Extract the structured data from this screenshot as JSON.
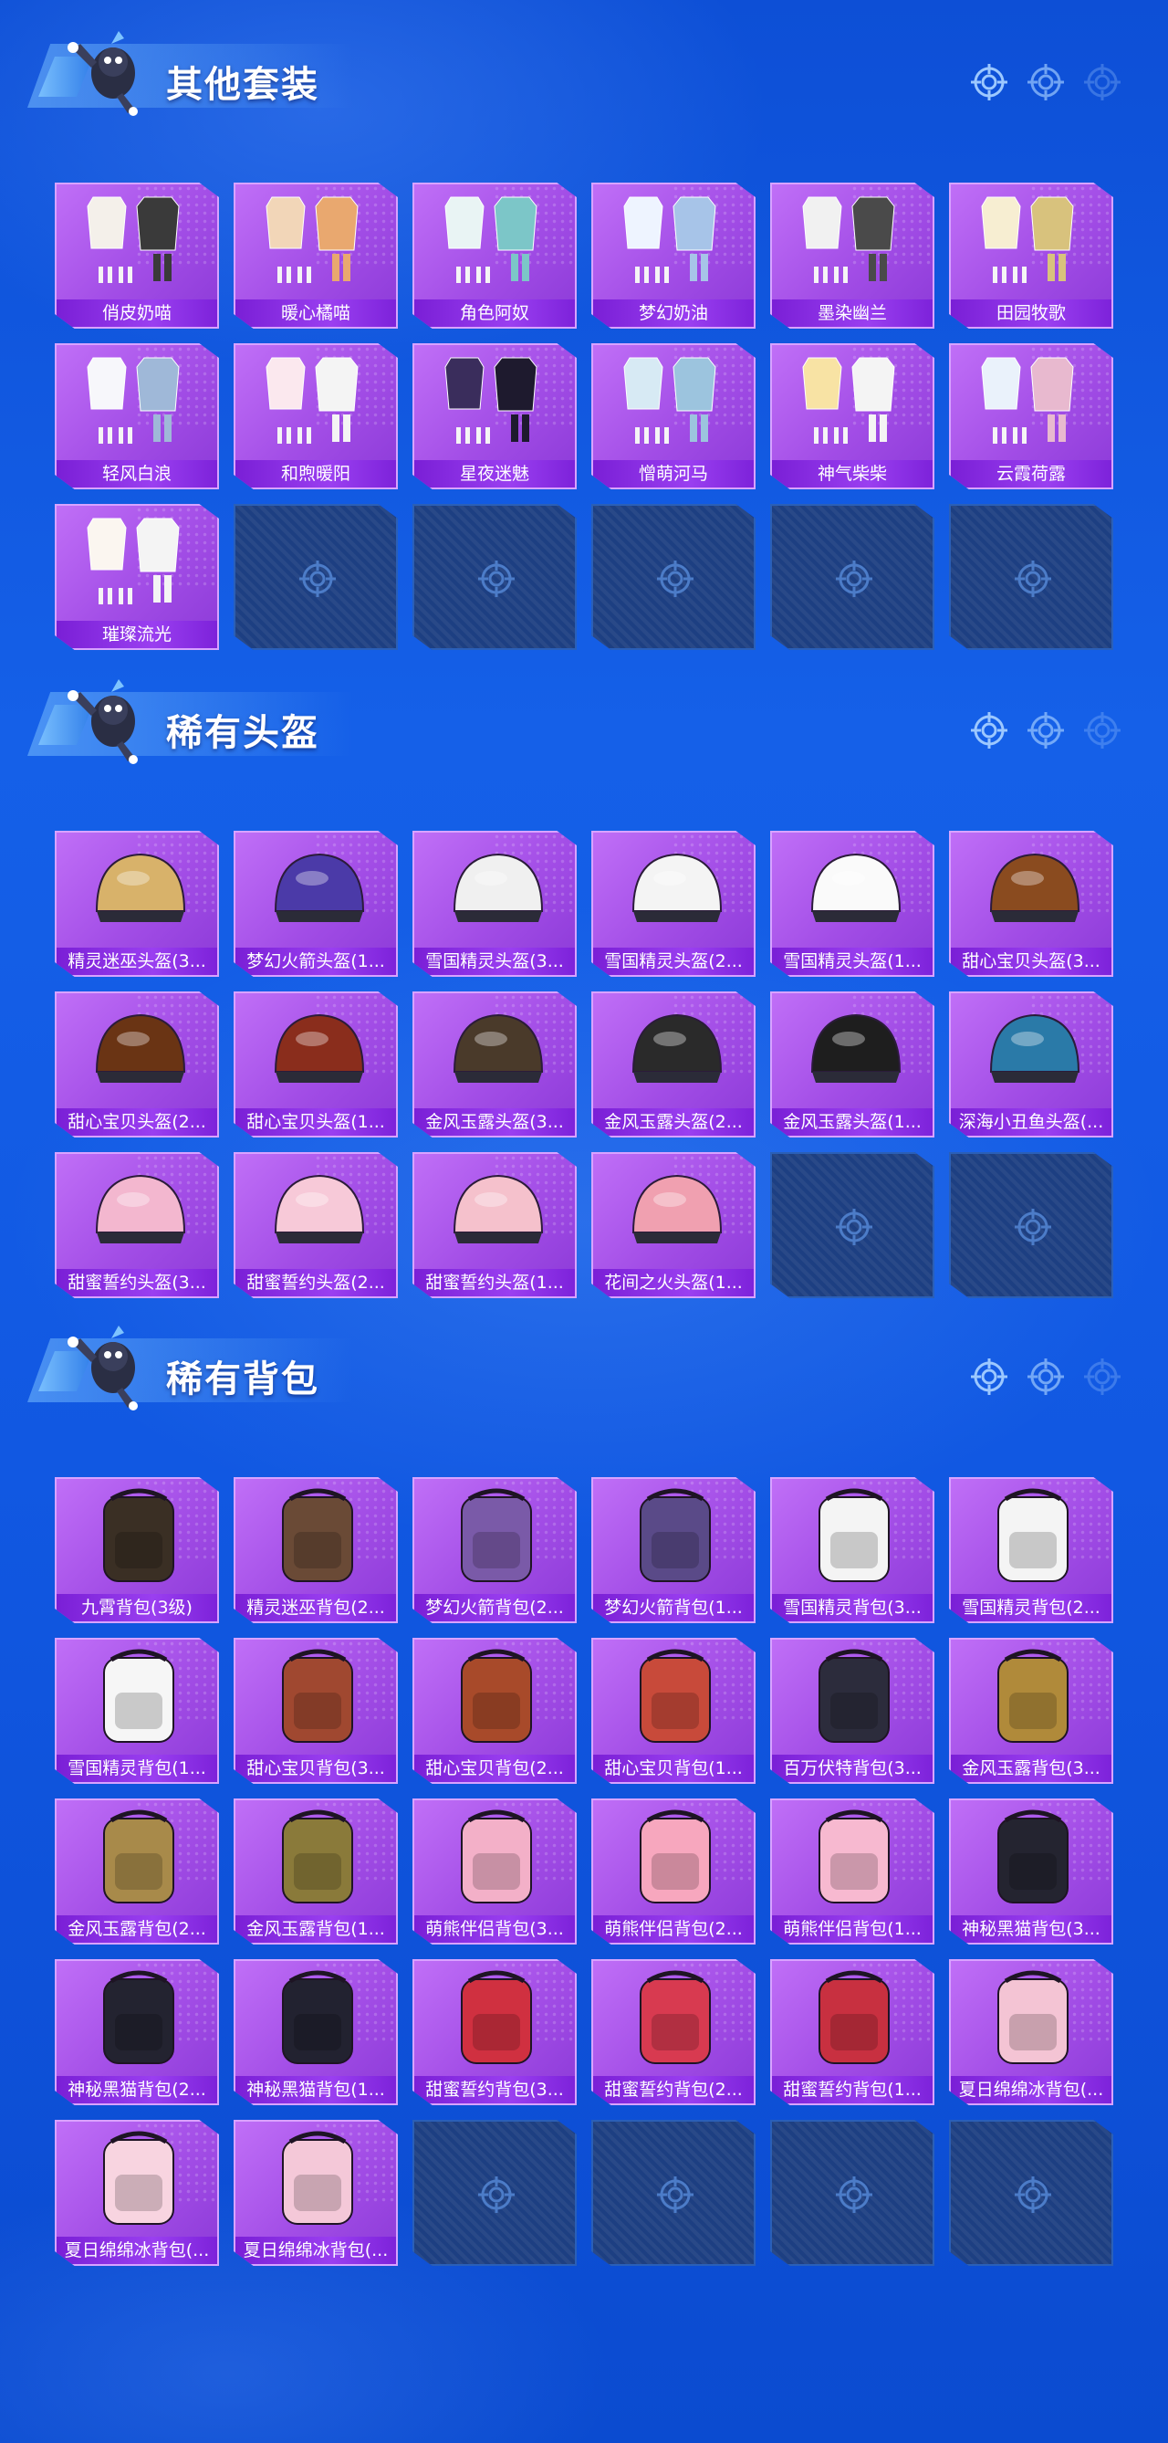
{
  "colors": {
    "background": "#1158e2",
    "card_purple": "#a24de6",
    "card_label": "#7a1fd6",
    "empty_slot": "#1d3f82"
  },
  "sections": [
    {
      "title": "其他套装",
      "item_kind": "outfit",
      "items": [
        "俏皮奶喵",
        "暖心橘喵",
        "角色阿奴",
        "梦幻奶油",
        "墨染幽兰",
        "田园牧歌",
        "轻风白浪",
        "和煦暖阳",
        "星夜迷魅",
        "憎萌河马",
        "神气柴柴",
        "云霞荷露",
        "璀璨流光"
      ],
      "empty_slots": 5
    },
    {
      "title": "稀有头盔",
      "item_kind": "helmet",
      "items": [
        "精灵迷巫头盔(3...",
        "梦幻火箭头盔(1...",
        "雪国精灵头盔(3...",
        "雪国精灵头盔(2...",
        "雪国精灵头盔(1...",
        "甜心宝贝头盔(3...",
        "甜心宝贝头盔(2...",
        "甜心宝贝头盔(1...",
        "金风玉露头盔(3...",
        "金风玉露头盔(2...",
        "金风玉露头盔(1...",
        "深海小丑鱼头盔(...",
        "甜蜜誓约头盔(3...",
        "甜蜜誓约头盔(2...",
        "甜蜜誓约头盔(1...",
        "花间之火头盔(1..."
      ],
      "empty_slots": 2
    },
    {
      "title": "稀有背包",
      "item_kind": "backpack",
      "items": [
        "九霄背包(3级)",
        "精灵迷巫背包(2...",
        "梦幻火箭背包(2...",
        "梦幻火箭背包(1...",
        "雪国精灵背包(3...",
        "雪国精灵背包(2...",
        "雪国精灵背包(1...",
        "甜心宝贝背包(3...",
        "甜心宝贝背包(2...",
        "甜心宝贝背包(1...",
        "百万伏特背包(3...",
        "金风玉露背包(3...",
        "金风玉露背包(2...",
        "金风玉露背包(1...",
        "萌熊伴侣背包(3...",
        "萌熊伴侣背包(2...",
        "萌熊伴侣背包(1...",
        "神秘黑猫背包(3...",
        "神秘黑猫背包(2...",
        "神秘黑猫背包(1...",
        "甜蜜誓约背包(3...",
        "甜蜜誓约背包(2...",
        "甜蜜誓约背包(1...",
        "夏日绵绵冰背包(...",
        "夏日绵绵冰背包(...",
        "夏日绵绵冰背包(..."
      ],
      "empty_slots": 4
    }
  ]
}
